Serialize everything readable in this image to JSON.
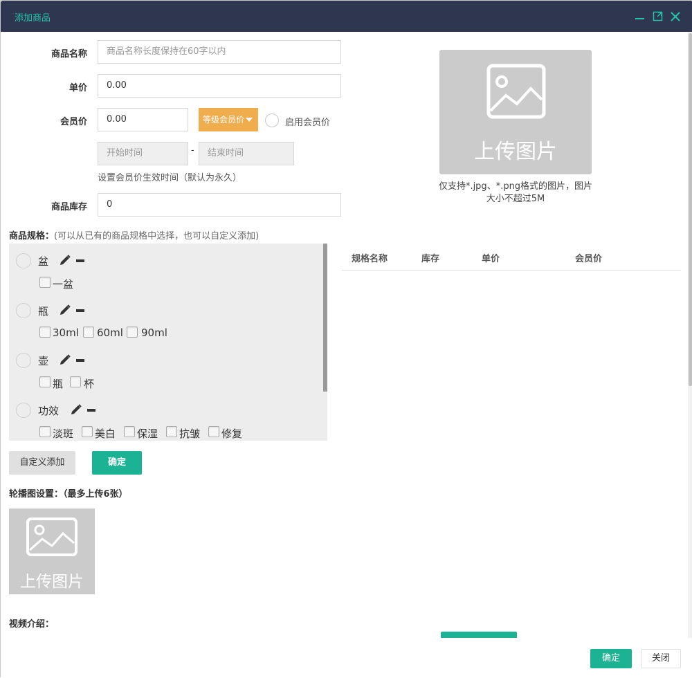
{
  "window": {
    "title": "添加商品"
  },
  "form": {
    "name_label": "商品名称",
    "name_placeholder": "商品名称长度保持在60字以内",
    "price_label": "单价",
    "price_value": "0.00",
    "member_price_label": "会员价",
    "member_price_value": "0.00",
    "level_button": "等级会员价",
    "enable_member_label": "启用会员价",
    "start_time_placeholder": "开始时间",
    "end_time_placeholder": "结束时间",
    "dash": "-",
    "time_note": "设置会员价生效时间（默认为永久）",
    "stock_label": "商品库存",
    "stock_value": "0"
  },
  "image_upload": {
    "text": "上传图片",
    "note_line1": "仅支持*.jpg、*.png格式的图片，图片",
    "note_line2": "大小不超过5M"
  },
  "spec": {
    "title": "商品规格：",
    "hint": "(可以从已有的商品规格中选择，也可以自定义添加)",
    "groups": [
      {
        "name": "盆",
        "options": [
          "一盆"
        ]
      },
      {
        "name": "瓶",
        "options": [
          "30ml",
          "60ml",
          "90ml"
        ]
      },
      {
        "name": "壶",
        "options": [
          "瓶",
          "杯"
        ]
      },
      {
        "name": "功效",
        "options": [
          "淡斑",
          "美白",
          "保湿",
          "抗皱",
          "修复"
        ]
      }
    ],
    "table_headers": [
      "规格名称",
      "库存",
      "单价",
      "会员价"
    ],
    "custom_add_button": "自定义添加",
    "confirm_button": "确定"
  },
  "carousel": {
    "title": "轮播图设置：（最多上传6张）",
    "upload_text": "上传图片"
  },
  "video": {
    "title": "视频介绍："
  },
  "footer": {
    "confirm": "确定",
    "close": "关闭"
  },
  "colors": {
    "titlebar": "#2f3650",
    "accent": "#1bb394",
    "orange": "#f0ad4e"
  }
}
